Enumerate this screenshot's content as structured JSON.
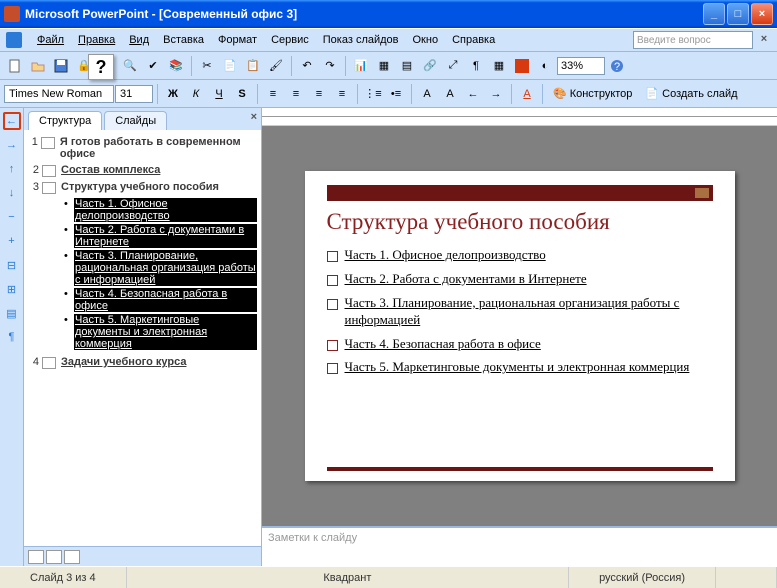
{
  "window": {
    "title": "Microsoft PowerPoint - [Современный офис 3]"
  },
  "menu": {
    "file": "Файл",
    "edit": "Правка",
    "view": "Вид",
    "insert": "Вставка",
    "format": "Формат",
    "tools": "Сервис",
    "show": "Показ слайдов",
    "window": "Окно",
    "help": "Справка"
  },
  "askbox": "Введите вопрос",
  "toolbar": {
    "zoom": "33%",
    "font": "Times New Roman",
    "size": "31",
    "designer": "Конструктор",
    "newslide": "Создать слайд"
  },
  "tooltip": "?",
  "tabs": {
    "outline": "Структура",
    "slides": "Слайды"
  },
  "outline": {
    "s1": {
      "num": "1",
      "title": "Я готов работать в современном офисе"
    },
    "s2": {
      "num": "2",
      "title": "Состав комплекса"
    },
    "s3": {
      "num": "3",
      "title": "Структура учебного пособия",
      "b1": "Часть 1. Офисное делопроизводство",
      "b2": "Часть 2. Работа с документами в Интернете",
      "b3": "Часть 3. Планирование, рациональная организация работы с информацией",
      "b4": "Часть 4. Безопасная работа в офисе",
      "b5": "Часть 5. Маркетинговые документы и электронная коммерция"
    },
    "s4": {
      "num": "4",
      "title": "Задачи учебного курса"
    }
  },
  "slide": {
    "title": "Структура учебного пособия",
    "i1": "Часть 1. Офисное делопроизводство",
    "i2": "Часть 2. Работа с документами в Интернете",
    "i3": "Часть 3. Планирование, рациональная организация работы с информацией",
    "i4": "Часть 4. Безопасная работа в офисе",
    "i5": "Часть 5. Маркетинговые документы и электронная коммерция"
  },
  "notes": "Заметки к слайду",
  "status": {
    "slide": "Слайд 3 из 4",
    "layout": "Квадрант",
    "lang": "русский (Россия)"
  }
}
